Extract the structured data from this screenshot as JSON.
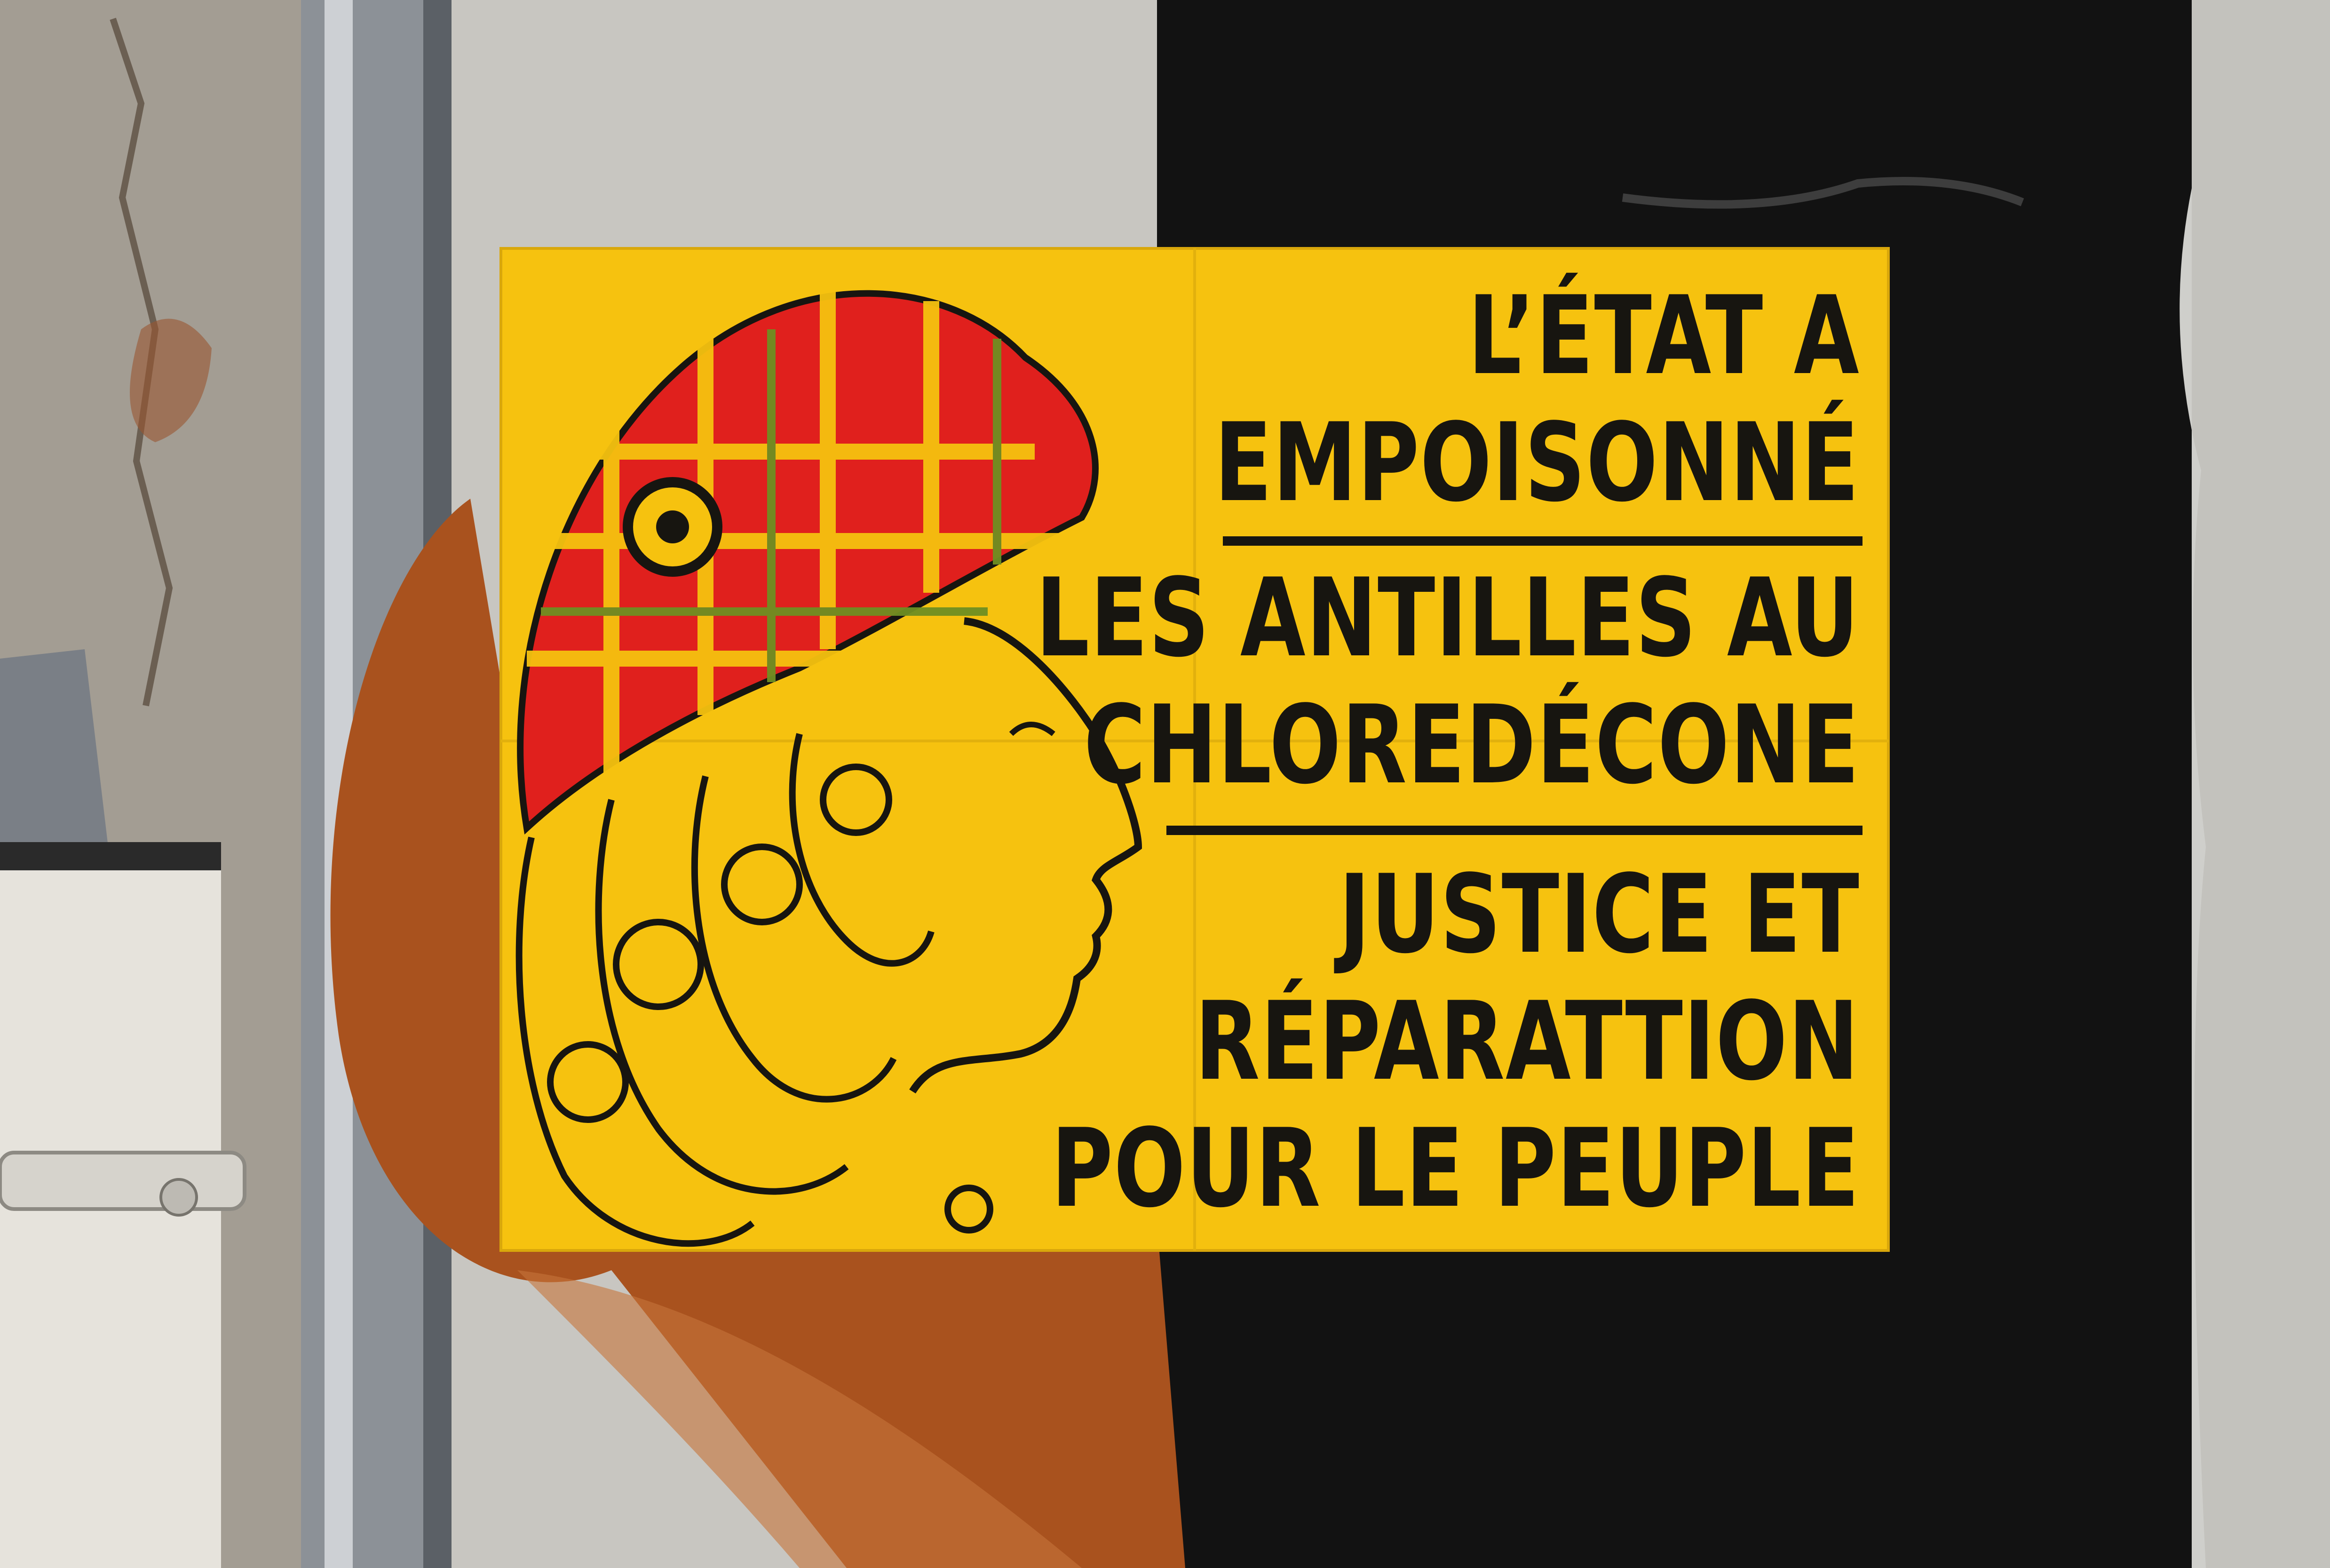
{
  "poster": {
    "lines": [
      "L’ÉTAT A",
      "EMPOISONNÉ",
      "LES ANTILLES AU",
      "CHLOREDÉCONE",
      "JUSTICE ET",
      "RÉPARATTION",
      "POUR LE PEUPLE"
    ]
  },
  "colors": {
    "poster_yellow": "#f6c20f",
    "ink": "#171510",
    "madras_red": "#e0201d",
    "madras_green": "#6f8f22",
    "wall_black": "#121212",
    "wall_grey": "#b9b6ae",
    "rust": "#a9521e"
  }
}
